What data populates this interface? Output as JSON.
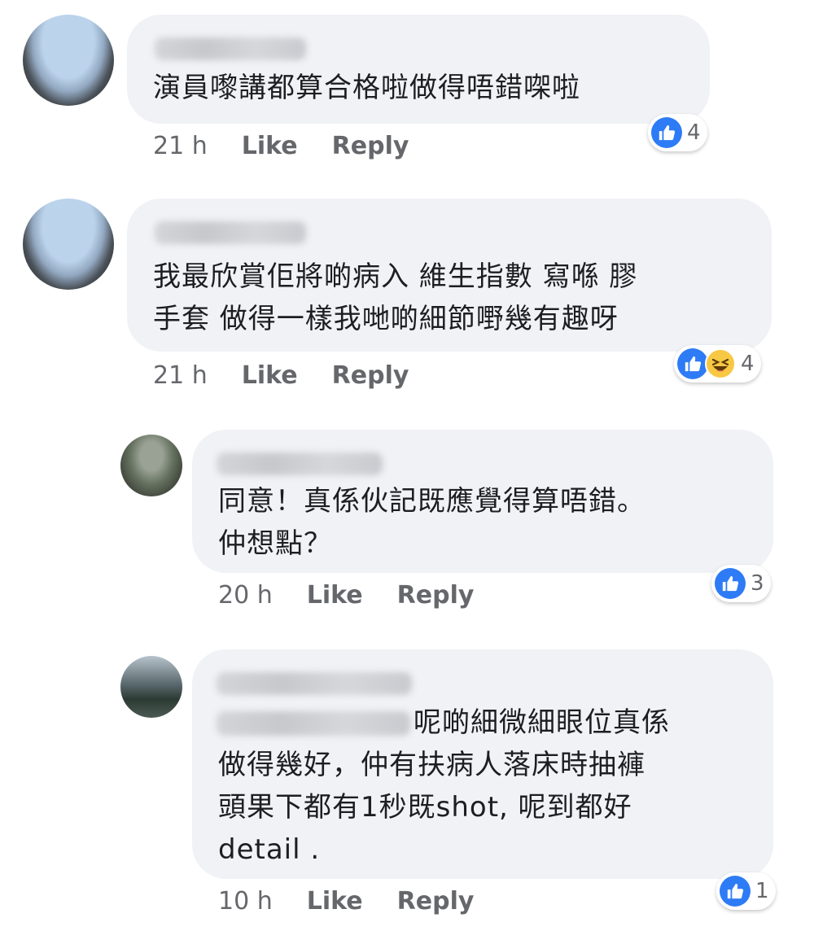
{
  "comments": [
    {
      "text": "演員嚟講都算合格啦做得唔錯㗎啦",
      "time": "21 h",
      "like_label": "Like",
      "reply_label": "Reply",
      "reactions": [
        "like-icon"
      ],
      "reaction_count": "4"
    },
    {
      "text": "我最欣賞佢將啲病入 維生指數 寫喺 膠\n手套 做得一樣我哋啲細節嘢幾有趣呀",
      "time": "21 h",
      "like_label": "Like",
      "reply_label": "Reply",
      "reactions": [
        "like-icon",
        "haha-icon"
      ],
      "reaction_count": "4"
    },
    {
      "text": "同意！真係伙記既應覺得算唔錯。\n仲想點？",
      "time": "20 h",
      "like_label": "Like",
      "reply_label": "Reply",
      "reactions": [
        "like-icon"
      ],
      "reaction_count": "3"
    },
    {
      "text_line1": "呢啲細微細眼位真係",
      "text_rest": "做得幾好，仲有扶病人落床時抽褲\n頭果下都有1秒既shot, 呢到都好\ndetail .",
      "time": "10 h",
      "like_label": "Like",
      "reply_label": "Reply",
      "reactions": [
        "like-icon"
      ],
      "reaction_count": "1"
    }
  ],
  "colors": {
    "bubble": "#f0f2f5",
    "like_blue": "#2e7bf6",
    "meta_gray": "#65676b"
  }
}
